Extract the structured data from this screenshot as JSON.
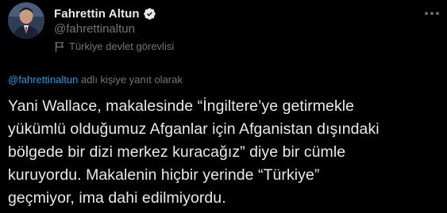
{
  "author": {
    "display_name": "Fahrettin Altun",
    "handle": "@fahrettinaltun",
    "verified": true,
    "label": "Türkiye devlet görevlisi",
    "avatar_icon": "profile-photo",
    "verified_icon": "verified-badge-icon",
    "label_icon": "flag-icon"
  },
  "menu": {
    "icon": "more-horizontal-icon"
  },
  "reply": {
    "mention": "@fahrettinaltun",
    "suffix": " adlı kişiye yanıt olarak"
  },
  "tweet": {
    "text": "Yani Wallace, makalesinde “İngiltere’ye getirmekle\nyükümlü olduğumuz Afganlar için Afganistan dışındaki\nbölgede bir dizi merkez kuracağız” diye bir cümle\nkuruyordu. Makalenin hiçbir yerinde “Türkiye”\ngeçmiyor, ima dahi edilmiyordu."
  },
  "colors": {
    "background": "#000000",
    "text_primary": "#e7e9ea",
    "text_secondary": "#71767b",
    "accent": "#1d9bf0"
  }
}
